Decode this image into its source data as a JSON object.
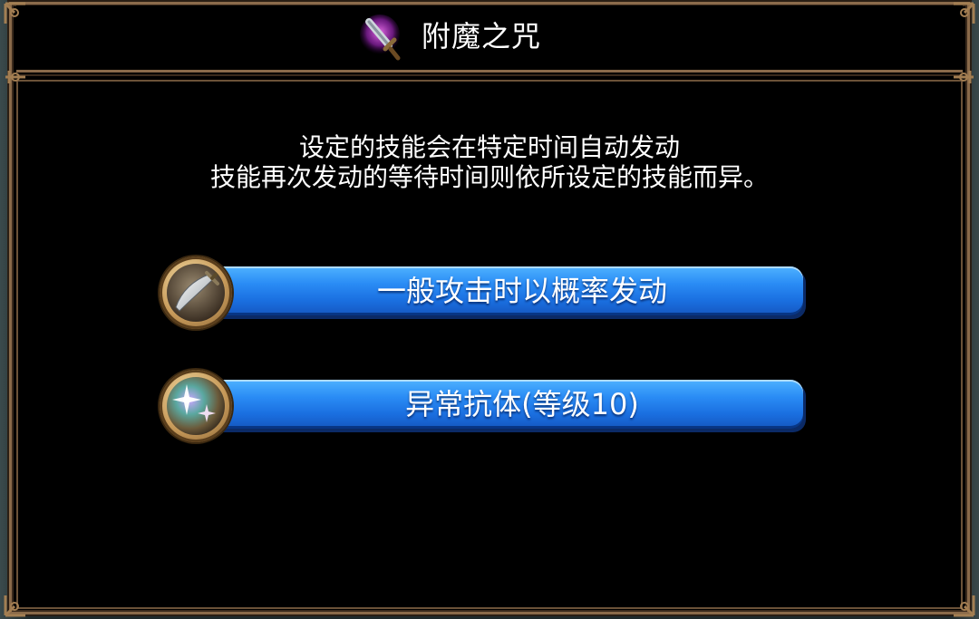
{
  "dialog": {
    "title": "附魔之咒",
    "title_icon": "enchanted-sword-icon",
    "description_lines": [
      "设定的技能会在特定时间自动发动",
      "技能再次发动的等待时间则依所设定的技能而异。"
    ]
  },
  "options": [
    {
      "label": "一般攻击时以概率发动",
      "icon": "sword-icon"
    },
    {
      "label": "异常抗体(等级10)",
      "icon": "sparkle-orb-icon"
    }
  ],
  "colors": {
    "frame": "#8a6a4a",
    "button_blue": "#2a8cf5",
    "background": "#000000",
    "text": "#ffffff"
  }
}
